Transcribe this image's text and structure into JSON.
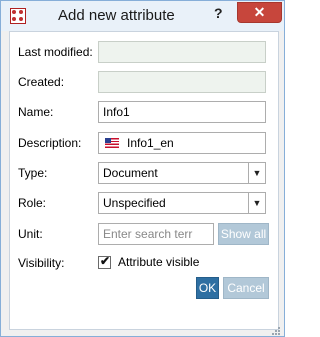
{
  "dialog": {
    "title": "Add new attribute",
    "help_label": "?",
    "close_label": "✕"
  },
  "form": {
    "last_modified": {
      "label": "Last modified:",
      "value": ""
    },
    "created": {
      "label": "Created:",
      "value": ""
    },
    "name": {
      "label": "Name:",
      "value": "Info1"
    },
    "description": {
      "label": "Description:",
      "value": "Info1_en",
      "flag_icon": "us-flag-icon"
    },
    "type": {
      "label": "Type:",
      "value": "Document"
    },
    "role": {
      "label": "Role:",
      "value": "Unspecified"
    },
    "unit": {
      "label": "Unit:",
      "placeholder": "Enter search terr",
      "show_all_label": "Show all"
    },
    "visibility": {
      "label": "Visibility:",
      "checkbox_label": "Attribute visible",
      "checked": true
    }
  },
  "buttons": {
    "ok_label": "OK",
    "cancel_label": "Cancel"
  },
  "colors": {
    "accent": "#2e6fa2",
    "disabled_button": "#b2c8d8",
    "close": "#c7463c",
    "titlebar": "#e9f1f9"
  }
}
